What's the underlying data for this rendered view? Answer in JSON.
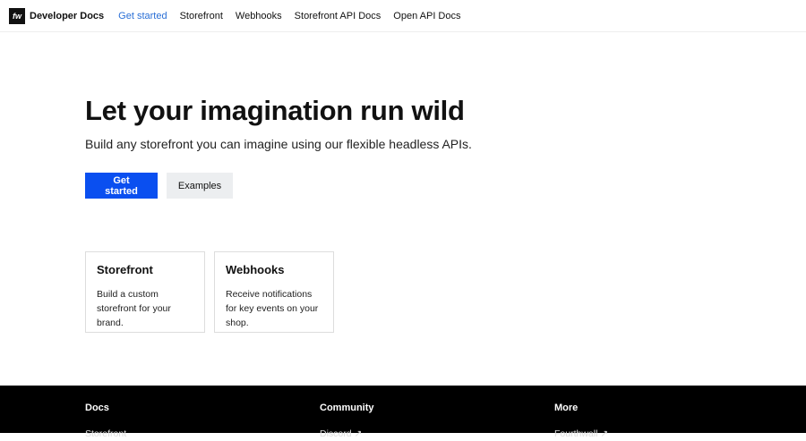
{
  "nav": {
    "logo": "fw",
    "brand": "Developer Docs",
    "links": [
      "Get started",
      "Storefront",
      "Webhooks",
      "Storefront API Docs",
      "Open API Docs"
    ]
  },
  "hero": {
    "title": "Let your imagination run wild",
    "subtitle": "Build any storefront you can imagine using our flexible headless APIs.",
    "primary": "Get started",
    "secondary": "Examples"
  },
  "cards": [
    {
      "title": "Storefront",
      "text": "Build a custom storefront for your brand."
    },
    {
      "title": "Webhooks",
      "text": "Receive notifications for key events on your shop."
    }
  ],
  "footer": {
    "cols": [
      {
        "title": "Docs",
        "link": "Storefront"
      },
      {
        "title": "Community",
        "link": "Discord ↗"
      },
      {
        "title": "More",
        "link": "Fourthwall ↗"
      }
    ]
  }
}
